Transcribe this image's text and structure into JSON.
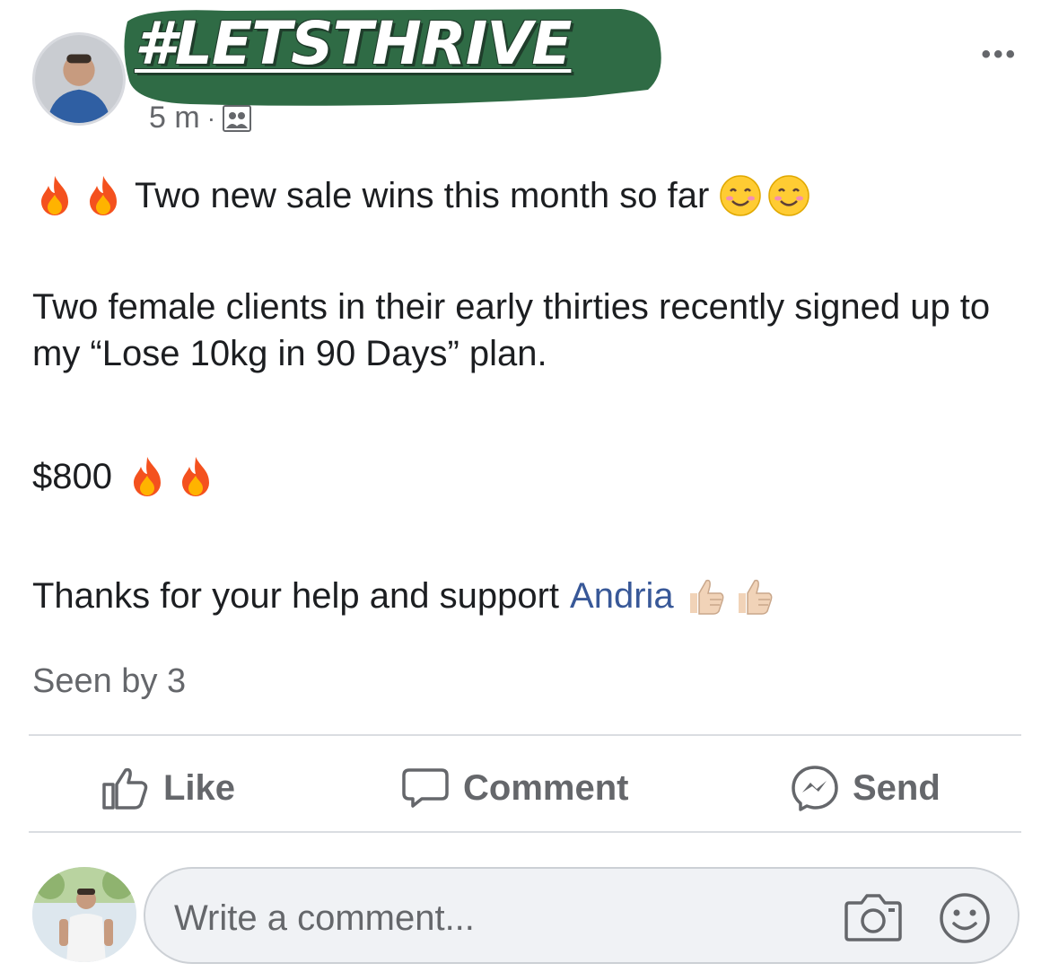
{
  "post": {
    "hashtag": "#LETSTHRIVE",
    "time": "5 m",
    "separator": "·",
    "more_label": "•••",
    "line1_text": "Two new sale wins this month so far",
    "line2_text": "Two female clients in their early thirties recently signed up to my “Lose 10kg in 90 Days” plan.",
    "line3_text": "$800",
    "line4_text": "Thanks for your help and support",
    "mention": "Andria",
    "seen_by": "Seen by 3"
  },
  "actions": {
    "like_label": "Like",
    "comment_label": "Comment",
    "send_label": "Send"
  },
  "composer": {
    "placeholder": "Write a comment..."
  },
  "icons": {
    "fire": "fire-emoji",
    "smile": "smiling-face-emoji",
    "thumbs": "thumbs-up-emoji",
    "group": "group-icon",
    "camera": "camera-icon",
    "emoji_picker": "smiley-icon"
  },
  "colors": {
    "text": "#1c1e21",
    "secondary": "#65676b",
    "mention": "#385898",
    "banner": "#2f6b45"
  }
}
